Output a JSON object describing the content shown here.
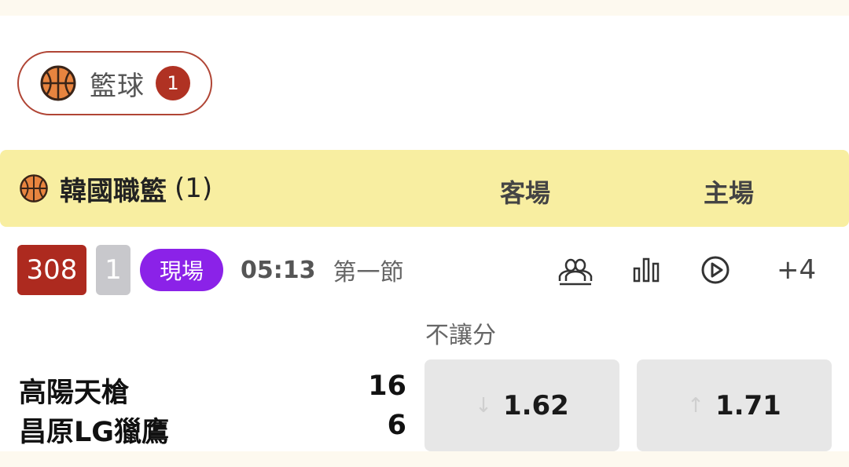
{
  "sport_filter": {
    "icon": "basketball-icon",
    "label": "籃球",
    "count": "1",
    "accent": "#b03223"
  },
  "league": {
    "icon": "basketball-icon",
    "name": "韓國職籃",
    "count": "(1)",
    "col_away": "客場",
    "col_home": "主場",
    "background": "#f8eea1"
  },
  "match": {
    "id": "308",
    "index": "1",
    "live_label": "現場",
    "clock": "05:13",
    "period": "第一節",
    "actions": {
      "people_icon": "people-icon",
      "stats_icon": "bar-chart-icon",
      "play_icon": "play-circle-icon",
      "more_label": "+4"
    },
    "market_label": "不讓分",
    "team_a": {
      "name": "高陽天槍",
      "score": "16"
    },
    "team_b": {
      "name": "昌原LG獵鷹",
      "score": "6"
    },
    "odds": {
      "away": {
        "arrow": "↓",
        "price": "1.62"
      },
      "home": {
        "arrow": "↑",
        "price": "1.71"
      }
    }
  }
}
